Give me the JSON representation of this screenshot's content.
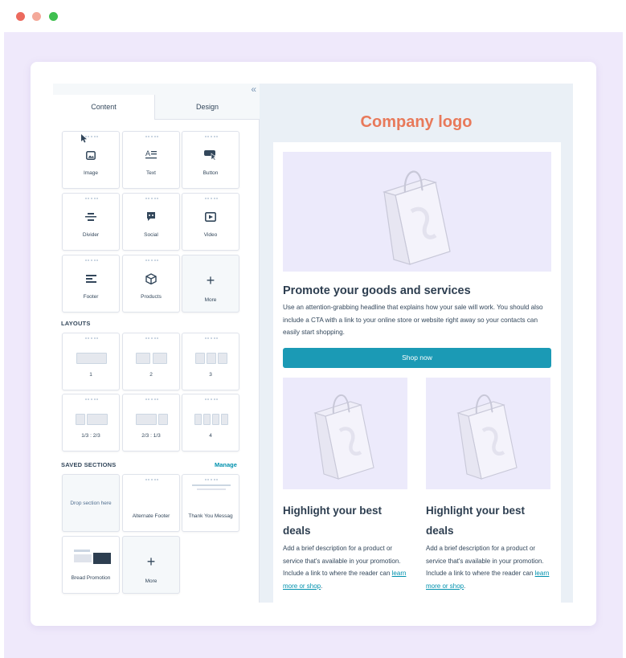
{
  "panel": {
    "tabs": [
      "Content",
      "Design"
    ],
    "collapse_icon": "double-chevron-left-icon",
    "modules": [
      {
        "label": "Image",
        "icon": "image-icon"
      },
      {
        "label": "Text",
        "icon": "text-icon"
      },
      {
        "label": "Button",
        "icon": "button-icon"
      },
      {
        "label": "Divider",
        "icon": "divider-icon"
      },
      {
        "label": "Social",
        "icon": "social-icon"
      },
      {
        "label": "Video",
        "icon": "video-icon"
      },
      {
        "label": "Footer",
        "icon": "footer-icon"
      },
      {
        "label": "Products",
        "icon": "products-icon"
      },
      {
        "label": "More",
        "icon": "plus-icon"
      }
    ],
    "layouts_title": "LAYOUTS",
    "layouts": [
      "1",
      "2",
      "3",
      "1/3 : 2/3",
      "2/3 : 1/3",
      "4"
    ],
    "saved_title": "SAVED SECTIONS",
    "manage_label": "Manage",
    "saved": [
      "Drop section here",
      "Alternate Footer",
      "Thank You Messag",
      "Bread Promotion",
      "More"
    ]
  },
  "email": {
    "logo": "Company logo",
    "headline": "Promote your goods and services",
    "body": "Use an attention-grabbing headline that explains how your sale will work. You should also include a CTA with a link to your online store or website right away so your contacts can easily start shopping.",
    "cta": "Shop now",
    "columns": [
      {
        "title": "Highlight your best deals",
        "body": "Add a brief description for a product or service that's available in your promotion. Include a link to where the reader can ",
        "link": "learn more or shop",
        "end": "."
      },
      {
        "title": "Highlight your best deals",
        "body": "Add a brief description for a product or service that's available in your promotion. Include a link to where the reader can ",
        "link": "learn more or shop",
        "end": "."
      }
    ]
  },
  "colors": {
    "accent": "#1b9ab5",
    "logo": "#e8795a",
    "backdrop": "#efe9fb"
  }
}
